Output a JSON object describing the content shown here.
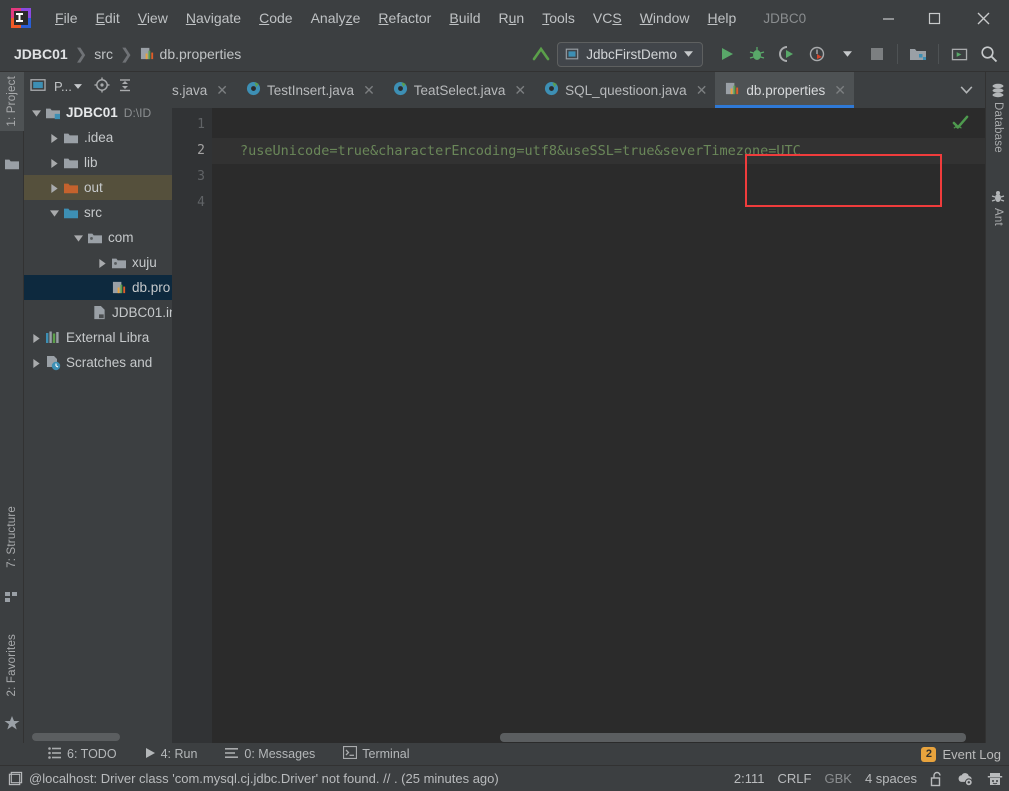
{
  "window": {
    "project_name": "JDBC0",
    "minimize": "—",
    "maximize": "□",
    "close": "✕"
  },
  "menubar": {
    "items": [
      {
        "label": "File",
        "mnemonic": "F"
      },
      {
        "label": "Edit",
        "mnemonic": "E"
      },
      {
        "label": "View",
        "mnemonic": "V"
      },
      {
        "label": "Navigate",
        "mnemonic": "N"
      },
      {
        "label": "Code",
        "mnemonic": "C"
      },
      {
        "label": "Analyze",
        "mnemonic": "z"
      },
      {
        "label": "Refactor",
        "mnemonic": "R"
      },
      {
        "label": "Build",
        "mnemonic": "B"
      },
      {
        "label": "Run",
        "mnemonic": "u"
      },
      {
        "label": "Tools",
        "mnemonic": "T"
      },
      {
        "label": "VCS",
        "mnemonic": "S"
      },
      {
        "label": "Window",
        "mnemonic": "W"
      },
      {
        "label": "Help",
        "mnemonic": "H"
      }
    ]
  },
  "toolbar": {
    "breadcrumb": [
      "JDBC01",
      "src",
      "db.properties"
    ],
    "breadcrumb_sep": "❯",
    "run_config": "JdbcFirstDemo",
    "icons": [
      "update-project-icon",
      "run-icon",
      "debug-icon",
      "run-coverage-icon",
      "profiler-icon",
      "stop-icon",
      "project-structure-icon",
      "select-opened-file-icon",
      "search-everywhere-icon"
    ]
  },
  "left_stripe": {
    "project": "1: Project",
    "structure": "7: Structure",
    "favorites": "2: Favorites"
  },
  "right_stripe": {
    "database": "Database",
    "ant": "Ant"
  },
  "project_panel": {
    "title": "P...",
    "tree": [
      {
        "indent": 0,
        "twisty": "down",
        "icon": "module-folder-icon",
        "label": "JDBC01",
        "bold": true,
        "path": "D:\\ID",
        "state": "normal"
      },
      {
        "indent": 1,
        "twisty": "right",
        "icon": "folder-gray-icon",
        "label": ".idea",
        "bold": false,
        "path": "",
        "state": "normal"
      },
      {
        "indent": 1,
        "twisty": "right",
        "icon": "folder-gray-icon",
        "label": "lib",
        "bold": false,
        "path": "",
        "state": "normal"
      },
      {
        "indent": 1,
        "twisty": "right",
        "icon": "folder-orange-icon",
        "label": "out",
        "bold": false,
        "path": "",
        "state": "selected-out"
      },
      {
        "indent": 1,
        "twisty": "down",
        "icon": "folder-blue-icon",
        "label": "src",
        "bold": false,
        "path": "",
        "state": "normal"
      },
      {
        "indent": 2,
        "twisty": "down",
        "icon": "package-icon",
        "label": "com",
        "bold": false,
        "path": "",
        "state": "normal"
      },
      {
        "indent": 3,
        "twisty": "right",
        "icon": "package-icon",
        "label": "xuju",
        "bold": false,
        "path": "",
        "state": "normal"
      },
      {
        "indent": 3,
        "twisty": "none",
        "icon": "properties-file-icon",
        "label": "db.pro",
        "bold": false,
        "path": "",
        "state": "selected-file"
      },
      {
        "indent": 2,
        "twisty": "none",
        "icon": "iml-file-icon",
        "label": "JDBC01.im",
        "bold": false,
        "path": "",
        "state": "normal"
      },
      {
        "indent": 0,
        "twisty": "right",
        "icon": "external-libraries-icon",
        "label": "External Libra",
        "bold": false,
        "path": "",
        "state": "normal"
      },
      {
        "indent": 0,
        "twisty": "right",
        "icon": "scratches-icon",
        "label": "Scratches and",
        "bold": false,
        "path": "",
        "state": "normal"
      }
    ]
  },
  "editor": {
    "tabs": [
      {
        "label": "s.java",
        "icon": "java-class-icon",
        "active": false,
        "clipped": true
      },
      {
        "label": "TestInsert.java",
        "icon": "java-class-icon",
        "active": false,
        "clipped": false
      },
      {
        "label": "TeatSelect.java",
        "icon": "java-class-icon",
        "active": false,
        "clipped": false
      },
      {
        "label": "SQL_questioon.java",
        "icon": "java-class-icon",
        "active": false,
        "clipped": false
      },
      {
        "label": "db.properties",
        "icon": "properties-file-icon",
        "active": true,
        "clipped": false
      }
    ],
    "tab_close": "✕",
    "tab_overflow_icon": "chevron-down-icon",
    "line_numbers": [
      "1",
      "2",
      "3",
      "4"
    ],
    "current_line": 2,
    "lines": [
      "",
      "?useUnicode=true&characterEncoding=utf8&useSSL=true&severTimezone=UTC",
      "",
      ""
    ],
    "highlight_text": "&severTimezone=UTC",
    "highlight_color": "#f03c3c",
    "inspection_status": "no-errors-checkmark"
  },
  "bottom_stripe": {
    "tabs": [
      {
        "label": "6: TODO",
        "mnemonic": "6",
        "icon": "todo-icon"
      },
      {
        "label": "4: Run",
        "mnemonic": "4",
        "icon": "run-icon"
      },
      {
        "label": "0: Messages",
        "mnemonic": "0",
        "icon": "messages-icon"
      },
      {
        "label": "Terminal",
        "mnemonic": "",
        "icon": "terminal-icon"
      }
    ],
    "event_log": "Event Log",
    "event_log_count": "2"
  },
  "statusbar": {
    "message": "@localhost: Driver class 'com.mysql.cj.jdbc.Driver' not found. // . (25 minutes ago)",
    "caret_position": "2:111",
    "line_separator": "CRLF",
    "encoding": "GBK",
    "indent": "4 spaces",
    "icons": [
      "unlock-icon",
      "inspection-settings-icon",
      "hector-icon",
      "memory-icon"
    ]
  },
  "colors": {
    "accent_blue": "#2f79d6",
    "string_green": "#6a8759",
    "warn_orange": "#e8a33d",
    "panel_bg": "#3c3f41",
    "editor_bg": "#2b2b2b"
  }
}
